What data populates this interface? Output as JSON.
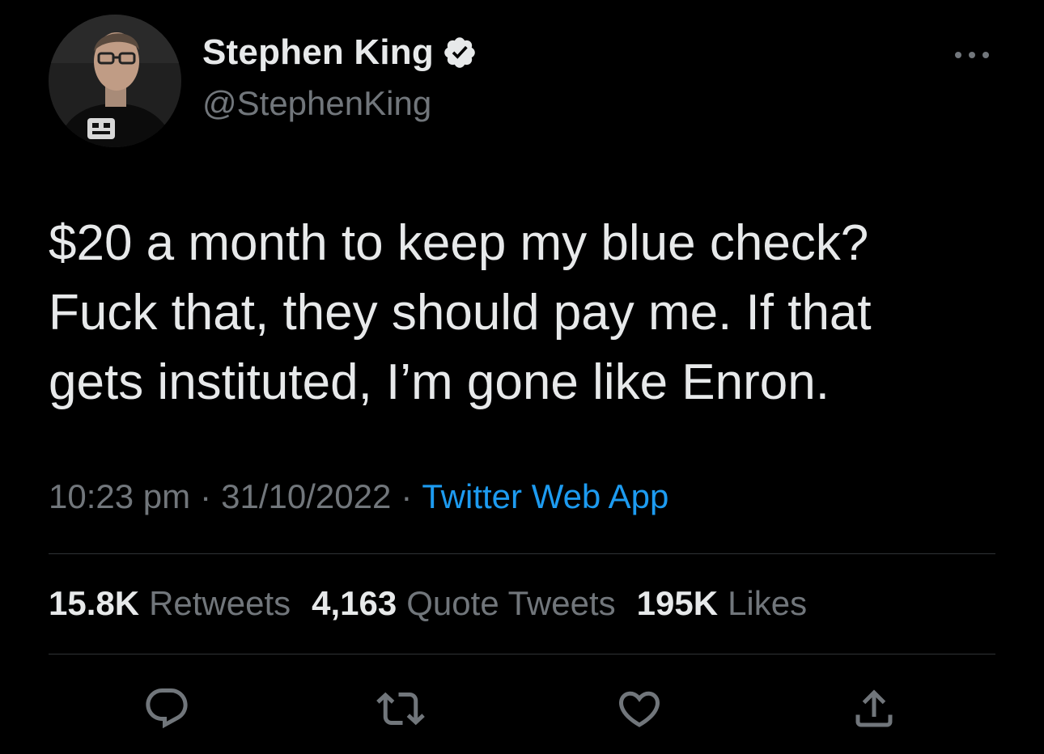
{
  "author": {
    "name": "Stephen King",
    "handle": "@StephenKing",
    "verified_icon": "verified-badge-icon"
  },
  "tweet": {
    "text": "$20 a month to keep my blue check?\nFuck that, they should pay me. If that\ngets instituted, I’m gone like Enron.",
    "time": "10:23 pm",
    "date": "31/10/2022",
    "separator": "·",
    "source": "Twitter Web App"
  },
  "stats": [
    {
      "value": "15.8K",
      "label": "Retweets"
    },
    {
      "value": "4,163",
      "label": "Quote Tweets"
    },
    {
      "value": "195K",
      "label": "Likes"
    }
  ],
  "actions": [
    "reply-icon",
    "retweet-icon",
    "like-icon",
    "share-icon"
  ],
  "colors": {
    "background": "#000000",
    "primary_text": "#e7e9ea",
    "secondary_text": "#71767b",
    "link": "#1d9bf0",
    "divider": "#2f3336"
  }
}
